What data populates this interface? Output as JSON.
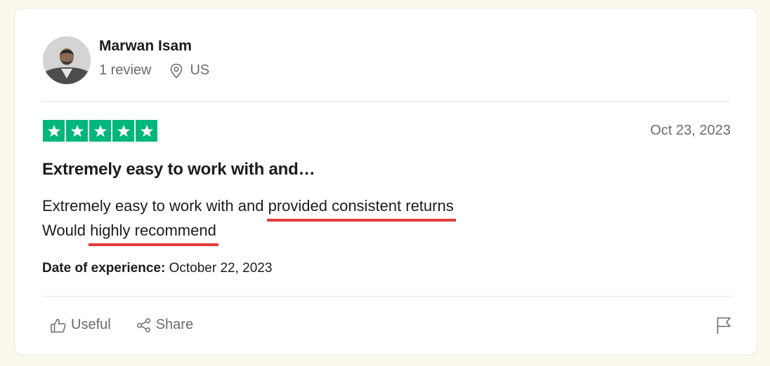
{
  "reviewer": {
    "name": "Marwan Isam",
    "review_count": "1 review",
    "country": "US"
  },
  "review": {
    "rating": 5,
    "rating_max": 5,
    "star_color": "#00b67a",
    "date": "Oct 23, 2023",
    "title": "Extremely easy to work with and…",
    "body_line1_plain": "Extremely easy to work with and ",
    "body_line1_highlight": "provided consistent returns",
    "body_line2_plain": "Would ",
    "body_line2_highlight": "highly recommend",
    "highlight_color": "#e63a3a",
    "experience_label": "Date of experience:",
    "experience_date": "October 22, 2023"
  },
  "actions": {
    "useful_label": "Useful",
    "share_label": "Share"
  },
  "icons": {
    "location": "location-pin-icon",
    "useful": "thumbs-up-icon",
    "share": "share-icon",
    "flag": "flag-icon",
    "star": "star-icon"
  }
}
